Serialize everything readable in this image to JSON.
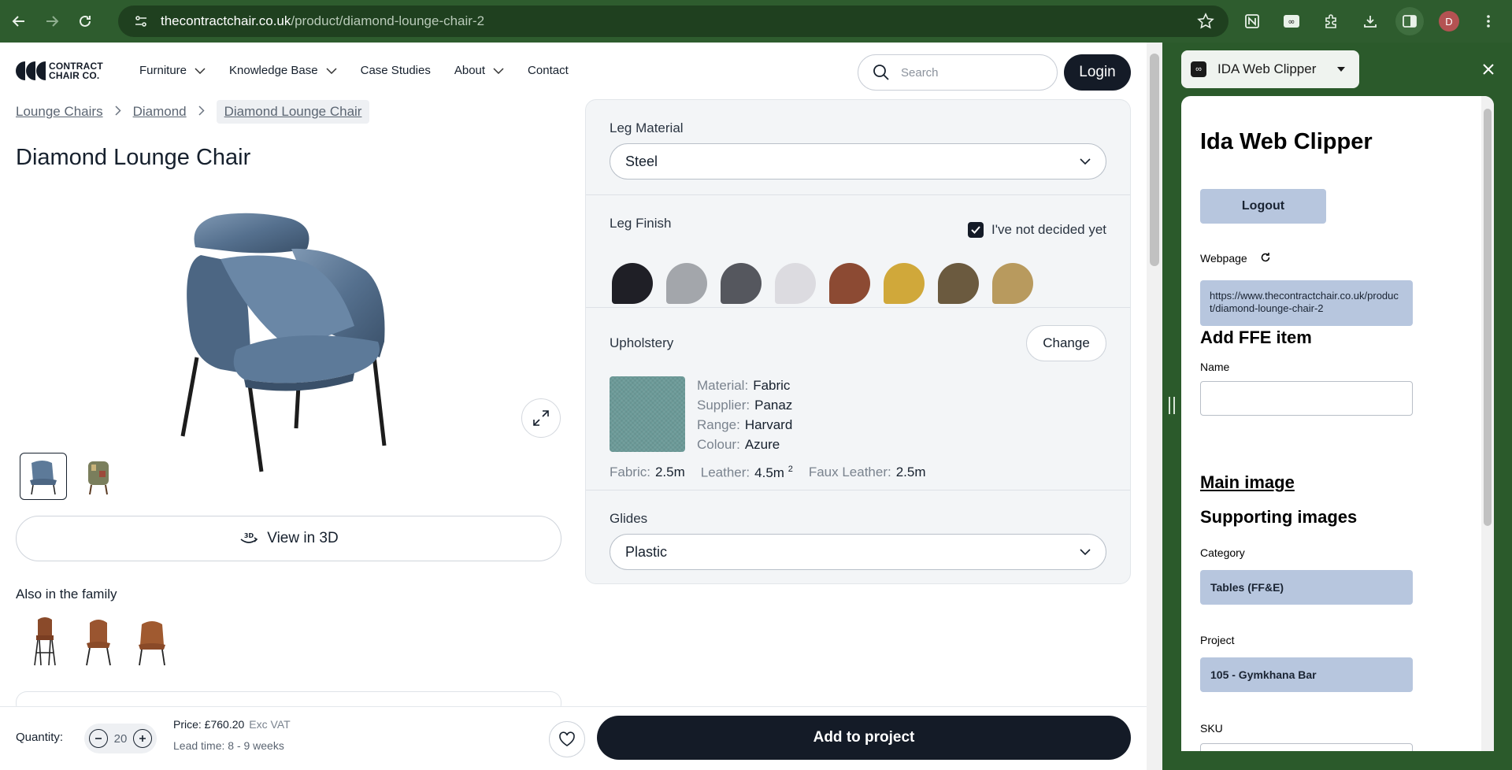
{
  "browser": {
    "url_host": "thecontractchair.co.uk",
    "url_path": "/product/diamond-lounge-chair-2",
    "avatar_initial": "D"
  },
  "header": {
    "logo_line1": "CONTRACT",
    "logo_line2": "CHAIR CO.",
    "menu": [
      {
        "label": "Furniture",
        "has_dropdown": true
      },
      {
        "label": "Knowledge Base",
        "has_dropdown": true
      },
      {
        "label": "Case Studies",
        "has_dropdown": false
      },
      {
        "label": "About",
        "has_dropdown": true
      },
      {
        "label": "Contact",
        "has_dropdown": false
      }
    ],
    "search_placeholder": "Search",
    "login_label": "Login"
  },
  "breadcrumb": [
    "Lounge Chairs",
    "Diamond",
    "Diamond Lounge Chair"
  ],
  "product": {
    "title": "Diamond Lounge Chair",
    "view3d_label": "View in 3D",
    "view3d_badge": "3D",
    "family_label": "Also in the family"
  },
  "options": {
    "leg_material": {
      "label": "Leg Material",
      "value": "Steel"
    },
    "leg_finish": {
      "label": "Leg Finish",
      "undecided_label": "I've not decided yet",
      "undecided_checked": true,
      "swatches": [
        "#1f1f26",
        "#a3a6ab",
        "#55575e",
        "#dcdbe0",
        "#8c4a33",
        "#d0a83a",
        "#6b5a3f",
        "#b89a5e"
      ]
    },
    "upholstery": {
      "label": "Upholstery",
      "change_label": "Change",
      "swatch_color": "#6b9a98",
      "details": [
        {
          "key": "Material:",
          "value": "Fabric"
        },
        {
          "key": "Supplier:",
          "value": "Panaz"
        },
        {
          "key": "Range:",
          "value": "Harvard"
        },
        {
          "key": "Colour:",
          "value": "Azure"
        }
      ],
      "amounts": [
        {
          "key": "Fabric:",
          "value": "2.5m",
          "sup": ""
        },
        {
          "key": "Leather:",
          "value": "4.5m",
          "sup": "2"
        },
        {
          "key": "Faux Leather:",
          "value": "2.5m",
          "sup": ""
        }
      ]
    },
    "glides": {
      "label": "Glides",
      "value": "Plastic"
    }
  },
  "purchase": {
    "quantity_label": "Quantity:",
    "quantity_value": "20",
    "price": "Price: £760.20",
    "price_note": "Exc VAT",
    "lead_time": "Lead time: 8 - 9 weeks",
    "add_label": "Add to project"
  },
  "extension": {
    "header_title": "IDA Web Clipper",
    "logo_glyph": "∞",
    "title": "Ida Web Clipper",
    "logout_label": "Logout",
    "webpage_label": "Webpage",
    "webpage_url": "https://www.thecontractchair.co.uk/product/diamond-lounge-chair-2",
    "add_item_heading": "Add FFE item",
    "name_label": "Name",
    "name_value": "",
    "main_image_label": "Main image",
    "supporting_images_label": "Supporting images",
    "category_label": "Category",
    "category_value": "Tables (FF&E)",
    "project_label": "Project",
    "project_value": "105 - Gymkhana Bar",
    "sku_label": "SKU"
  }
}
